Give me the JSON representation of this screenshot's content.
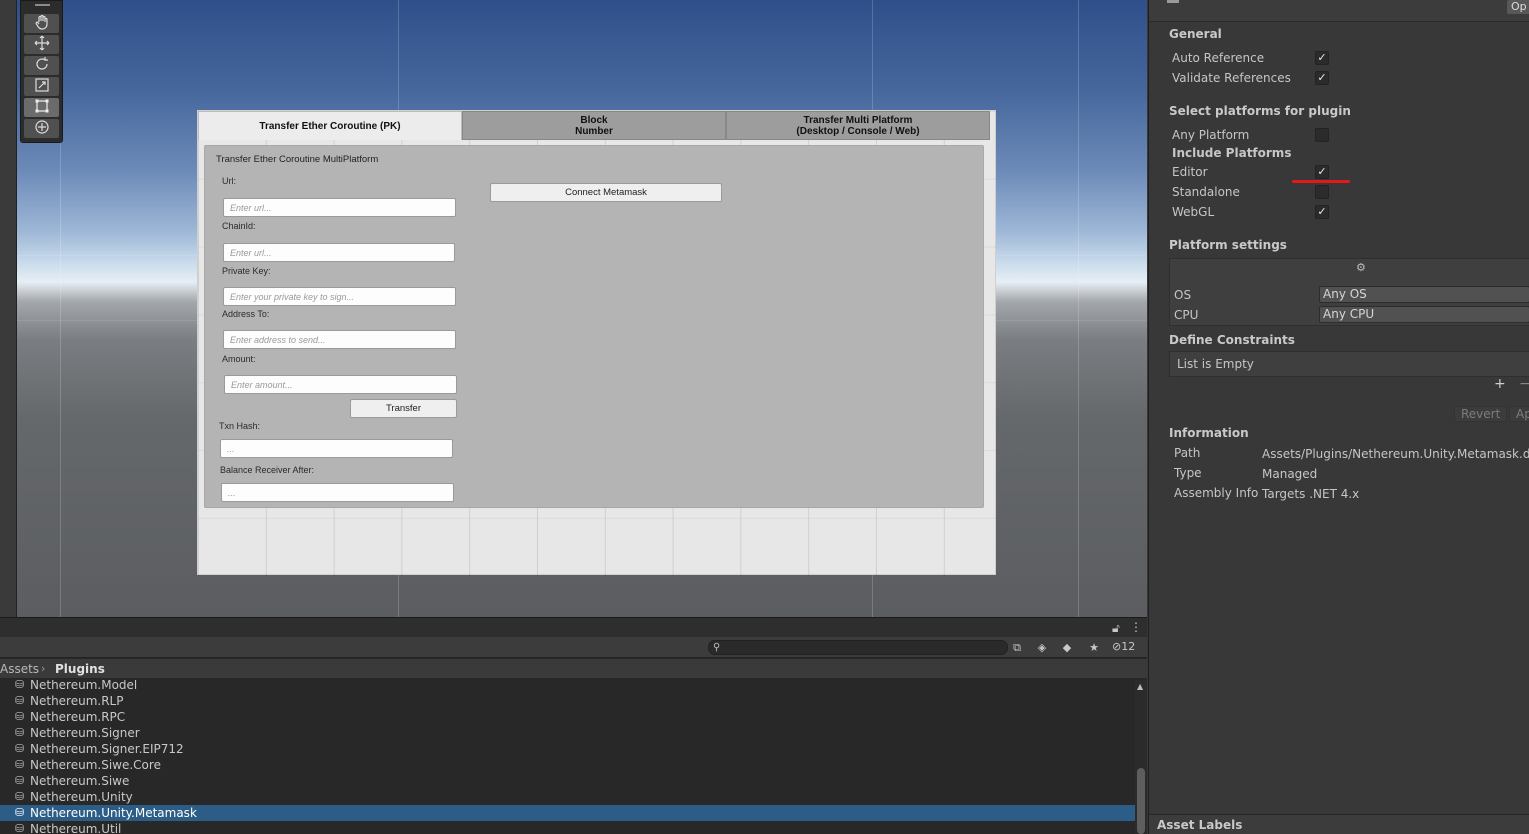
{
  "game_ui": {
    "tabs": [
      {
        "label": "Transfer Ether Coroutine (PK)"
      },
      {
        "label": "Block\nNumber"
      },
      {
        "label": "Transfer Multi Platform\n(Desktop / Console / Web)"
      }
    ],
    "section_title": "Transfer Ether Coroutine MultiPlatform",
    "fields": {
      "url": {
        "label": "Url:",
        "placeholder": "Enter url..."
      },
      "chain_id": {
        "label": "ChainId:",
        "placeholder": "Enter url..."
      },
      "private_key": {
        "label": "Private Key:",
        "placeholder": "Enter your private key to sign..."
      },
      "address_to": {
        "label": "Address To:",
        "placeholder": "Enter address to send..."
      },
      "amount": {
        "label": "Amount:",
        "placeholder": "Enter amount..."
      },
      "txn_hash": {
        "label": "Txn Hash:",
        "placeholder": "..."
      },
      "balance_after": {
        "label": "Balance Receiver After:",
        "placeholder": "..."
      }
    },
    "transfer_button": "Transfer",
    "connect_button": "Connect Metamask"
  },
  "inspector": {
    "top_button": "Op",
    "general": {
      "title": "General",
      "rows": [
        {
          "label": "Auto Reference",
          "checked": true
        },
        {
          "label": "Validate References",
          "checked": true
        }
      ]
    },
    "platforms": {
      "title": "Select platforms for plugin",
      "any_platform": {
        "label": "Any Platform",
        "checked": false
      },
      "include_title": "Include Platforms",
      "rows": [
        {
          "label": "Editor",
          "checked": true
        },
        {
          "label": "Standalone",
          "checked": false
        },
        {
          "label": "WebGL",
          "checked": true
        }
      ]
    },
    "platform_settings": {
      "title": "Platform settings",
      "os_label": "OS",
      "os_value": "Any OS",
      "cpu_label": "CPU",
      "cpu_value": "Any CPU"
    },
    "define_constraints": {
      "title": "Define Constraints",
      "empty_text": "List is Empty",
      "plus": "+",
      "minus": "−"
    },
    "revert_button": "Revert",
    "apply_button": "Ap",
    "information": {
      "title": "Information",
      "path_label": "Path",
      "path_value": "Assets/Plugins/Nethereum.Unity.Metamask.dll",
      "type_label": "Type",
      "type_value": "Managed",
      "assembly_label": "Assembly Info",
      "assembly_value": "Targets .NET 4.x"
    },
    "asset_labels": "Asset Labels",
    "colors": {
      "annotation": "#e01a1a"
    }
  },
  "project": {
    "search_placeholder": "",
    "hidden_count": "12",
    "breadcrumb": [
      "Assets",
      "Plugins"
    ],
    "files": [
      "Nethereum.Model",
      "Nethereum.RLP",
      "Nethereum.RPC",
      "Nethereum.Signer",
      "Nethereum.Signer.EIP712",
      "Nethereum.Siwe.Core",
      "Nethereum.Siwe",
      "Nethereum.Unity",
      "Nethereum.Unity.Metamask",
      "Nethereum.Util"
    ],
    "selected_file": "Nethereum.Unity.Metamask",
    "colors": {
      "selection": "#2c5d87"
    }
  },
  "icons": [
    "hand-icon",
    "move-icon",
    "rotate-icon",
    "scale-icon",
    "rect-icon",
    "transform-icon",
    "lock-icon",
    "kebab-icon",
    "search-icon",
    "plugin-icon"
  ]
}
